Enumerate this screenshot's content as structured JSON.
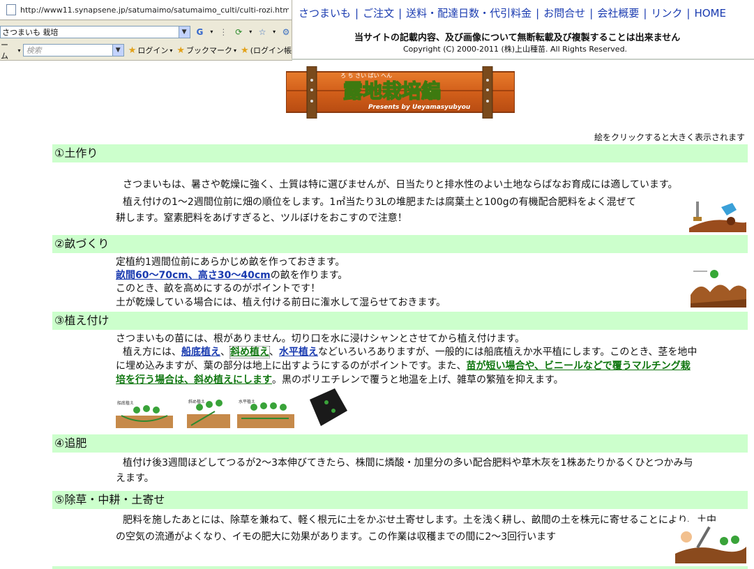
{
  "browser": {
    "url": "http://www11.synapsene.jp/satumaimo/satumaimo_culti/culti-rozi.html",
    "search_value": "さつまいも 栽培",
    "search_placeholder": "検索",
    "left_cut_label": "ーム",
    "login_label": "ログイン",
    "bookmark_label": "ブックマーク",
    "login_paren_label": "(ログイン帳"
  },
  "nav": {
    "items": [
      "さつまいも",
      "ご注文",
      "送料・配達日数・代引料金",
      "お問合せ",
      "会社概要",
      "リンク",
      "HOME"
    ],
    "separator": "|",
    "notice": "当サイトの記載内容、及び画像について無断転載及び複製することは出来ません",
    "copyright": "Copyright (C) 2000-2011 (株)上山種苗. All Rights Reserved."
  },
  "logo": {
    "ruby": "ろ ち さい ばい へん",
    "title": "露地栽培編",
    "subtitle": "Presents by Ueyamasyubyou"
  },
  "hint": "絵をクリックすると大きく表示されます",
  "sections": {
    "s1": {
      "title": "①土作り",
      "l1": "さつまいもは、暑さや乾燥に強く、土質は特に選びませんが、日当たりと排水性のよい土地ならばなお育成には適しています。",
      "l2": "植え付けの1～2週間位前に畑の順位をします。1㎡当たり3Lの堆肥または腐葉土と100gの有機配合肥料をよく混ぜて",
      "l3": "耕します。窒素肥料をあげすぎると、ツルぼけをおこすので注意！"
    },
    "s2": {
      "title": "②畝づくり",
      "l1": "定植約1週間位前にあらかじめ畝を作っておきます。",
      "l2_link": "畝間60～70cm、高さ30～40cm",
      "l2_rest": "の畝を作ります。",
      "l3": "このとき、畝を高めにするのがポイントです！",
      "l4": "土が乾燥している場合には、植え付ける前日に潅水して湿らせておきます。"
    },
    "s3": {
      "title": "③植え付け",
      "l1": "さつまいもの苗には、根がありません。切り口を水に浸けシャンとさせてから植え付けます。",
      "l2_a": "植え方には、",
      "link1": "船底植え",
      "comma": "、",
      "link2": "斜め植え",
      "comma2": "、",
      "link3": "水平植え",
      "l2_b": "などいろいろありますが、一般的には船底植えか水平植にします。このとき、茎を地中",
      "l3_a": "に埋め込みますが、葉の部分は地上に出すようにするのがポイントです。また、",
      "green1": "苗が短い場合や、ビニールなどで覆うマルチング栽",
      "green2": "培を行う場合は、斜め植えにします",
      "l4_rest": "。黒のポリエチレンで覆うと地温を上げ、雑草の繁殖を抑えます。",
      "thumb_labels": [
        "船底植え",
        "斜め植え",
        "水平植え"
      ]
    },
    "s4": {
      "title": "④追肥",
      "l1": "植付け後3週間ほどしてつるが2～3本伸びてきたら、株間に燐酸・加里分の多い配合肥料や草木灰を1株あたりかるくひとつかみ与",
      "l2": "えます。"
    },
    "s5": {
      "title": "⑤除草・中耕・土寄せ",
      "l1": "肥料を施したあとには、除草を兼ねて、軽く根元に土をかぶせ土寄せします。土を浅く耕し、畝間の土を株元に寄せることにより、土中",
      "l2": "の空気の流通がよくなり、イモの肥大に効果があります。この作業は収穫までの間に2～3回行います"
    }
  }
}
